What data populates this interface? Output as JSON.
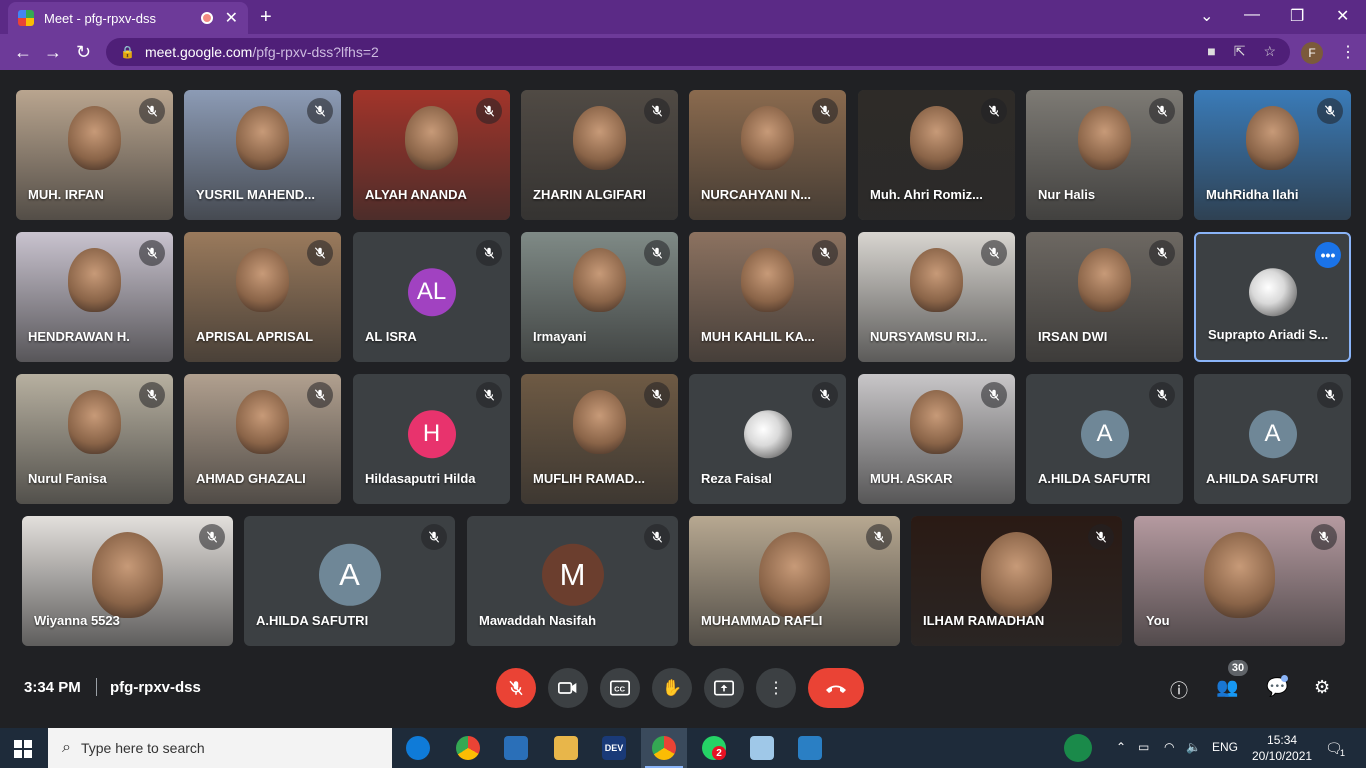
{
  "browser": {
    "tab_title": "Meet - pfg-rpxv-dss",
    "new_tab": "+",
    "url_domain": "meet.google.com",
    "url_path": "/pfg-rpxv-dss?lfhs=2",
    "profile_initial": "F"
  },
  "meeting": {
    "time": "3:34 PM",
    "code": "pfg-rpxv-dss",
    "participants_count": "30"
  },
  "participants": [
    {
      "name": "MUH. IRFAN",
      "video": true,
      "muted": true,
      "color": "#b9a58f"
    },
    {
      "name": "YUSRIL MAHEND...",
      "video": true,
      "muted": true,
      "color": "#8c9bb5"
    },
    {
      "name": "ALYAH ANANDA",
      "video": true,
      "muted": true,
      "color": "#a2342a"
    },
    {
      "name": "ZHARIN ALGIFARI",
      "video": true,
      "muted": true,
      "color": "#504a44"
    },
    {
      "name": "NURCAHYANI N...",
      "video": true,
      "muted": true,
      "color": "#8a6a4e"
    },
    {
      "name": "Muh. Ahri Romiz...",
      "video": true,
      "muted": true,
      "color": "#2e2b28"
    },
    {
      "name": "Nur Halis",
      "video": true,
      "muted": true,
      "color": "#7d7a74"
    },
    {
      "name": "MuhRidha Ilahi",
      "video": true,
      "muted": true,
      "color": "#3a7bb8"
    },
    {
      "name": "HENDRAWAN H.",
      "video": true,
      "muted": true,
      "color": "#c9c3cf"
    },
    {
      "name": "APRISAL APRISAL",
      "video": true,
      "muted": true,
      "color": "#9a7a5c"
    },
    {
      "name": "AL ISRA",
      "video": false,
      "muted": true,
      "initials": "AL",
      "avatar_color": "#a142c1"
    },
    {
      "name": "Irmayani",
      "video": true,
      "muted": true,
      "color": "#7f8a86"
    },
    {
      "name": "MUH KAHLIL KA...",
      "video": true,
      "muted": true,
      "color": "#8c7260"
    },
    {
      "name": "NURSYAMSU RIJ...",
      "video": true,
      "muted": true,
      "color": "#d8d5d0"
    },
    {
      "name": "IRSAN DWI",
      "video": true,
      "muted": true,
      "color": "#6d6862"
    },
    {
      "name": "Suprapto Ariadi S...",
      "video": false,
      "muted": false,
      "photo_avatar": true,
      "pinned": true
    },
    {
      "name": "Nurul Fanisa",
      "video": true,
      "muted": true,
      "color": "#b7b0a0"
    },
    {
      "name": "AHMAD GHAZALI",
      "video": true,
      "muted": true,
      "color": "#b1a08f"
    },
    {
      "name": "Hildasaputri Hilda",
      "video": false,
      "muted": true,
      "initials": "H",
      "avatar_color": "#e8336d"
    },
    {
      "name": "MUFLIH RAMAD...",
      "video": true,
      "muted": true,
      "color": "#6e5a44"
    },
    {
      "name": "Reza Faisal",
      "video": false,
      "muted": true,
      "photo_avatar": true
    },
    {
      "name": "MUH. ASKAR",
      "video": true,
      "muted": true,
      "color": "#c8c6c8"
    },
    {
      "name": "A.HILDA SAFUTRI",
      "video": false,
      "muted": true,
      "initials": "A",
      "avatar_color": "#6f8797"
    },
    {
      "name": "A.HILDA SAFUTRI",
      "video": false,
      "muted": true,
      "initials": "A",
      "avatar_color": "#6f8797"
    },
    {
      "name": "Wiyanna 5523",
      "video": true,
      "muted": true,
      "color": "#e3e0dc"
    },
    {
      "name": "A.HILDA SAFUTRI",
      "video": false,
      "muted": true,
      "initials": "A",
      "avatar_color": "#6f8797"
    },
    {
      "name": "Mawaddah Nasifah",
      "video": false,
      "muted": true,
      "initials": "M",
      "avatar_color": "#6b3e2e"
    },
    {
      "name": "MUHAMMAD RAFLI",
      "video": true,
      "muted": true,
      "color": "#b7a891"
    },
    {
      "name": "ILHAM RAMADHAN",
      "video": true,
      "muted": true,
      "color": "#2a1a14"
    },
    {
      "name": "You",
      "video": true,
      "muted": true,
      "color": "#b59aa0"
    }
  ],
  "taskbar": {
    "search_placeholder": "Type here to search",
    "lang": "ENG",
    "time": "15:34",
    "date": "20/10/2021",
    "whatsapp_badge": "2",
    "notif_count": "1",
    "dev_label": "DEV"
  }
}
